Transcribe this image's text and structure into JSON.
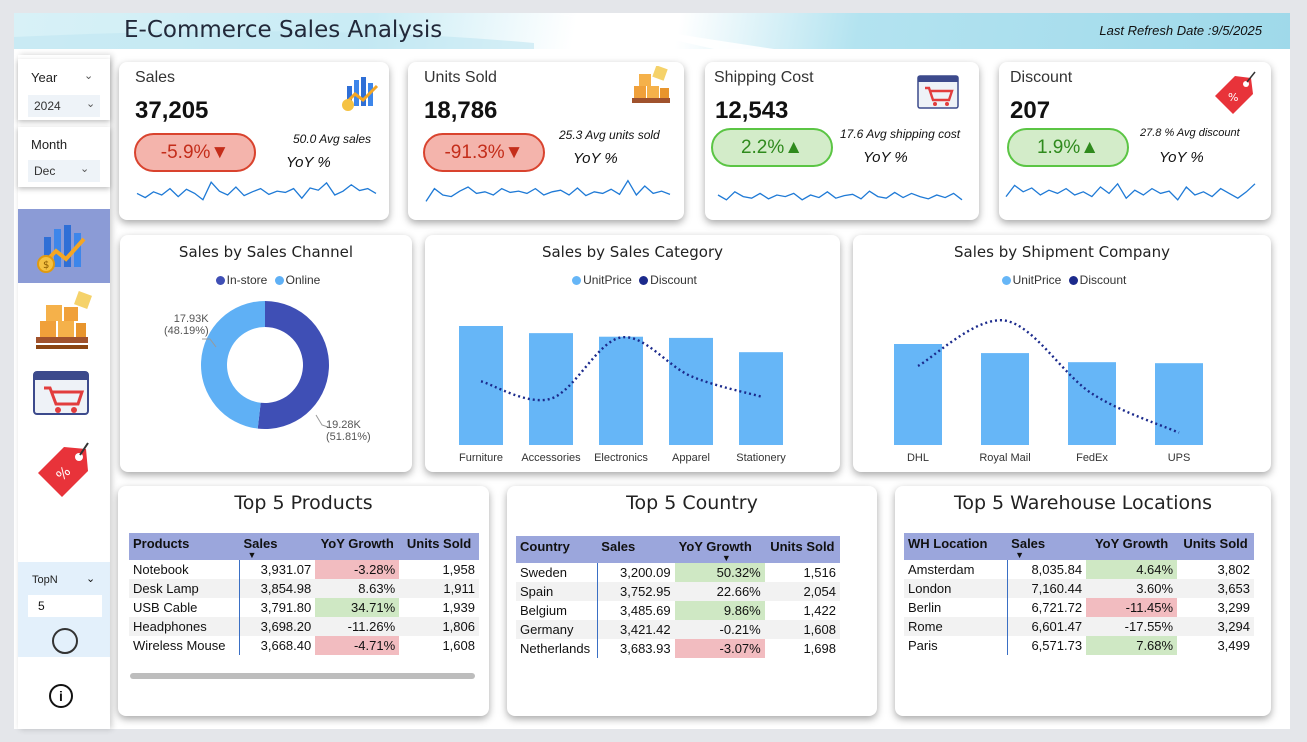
{
  "header": {
    "title": "E-Commerce Sales Analysis",
    "refresh": "Last Refresh Date :9/5/2025"
  },
  "sidebar": {
    "year": {
      "label": "Year",
      "value": "2024"
    },
    "month": {
      "label": "Month",
      "value": "Dec"
    },
    "nav": [
      {
        "icon": "sales-chart-icon",
        "active": true
      },
      {
        "icon": "boxes-icon"
      },
      {
        "icon": "cart-icon"
      },
      {
        "icon": "discount-tag-icon"
      }
    ],
    "topn": {
      "label": "TopN",
      "value": "5"
    }
  },
  "kpis": [
    {
      "name": "Sales",
      "value": "37,205",
      "change": "-5.9%▼",
      "trend": "neg",
      "avg": "50.0 Avg sales",
      "yoy": "YoY %",
      "spark": [
        0.55,
        0.42,
        0.6,
        0.5,
        0.7,
        0.45,
        0.68,
        0.55,
        0.35,
        0.9,
        0.62,
        0.5,
        0.75,
        0.48,
        0.6,
        0.7,
        0.52,
        0.62,
        0.58,
        0.7,
        0.4,
        0.72,
        0.65,
        0.88,
        0.5,
        0.62,
        0.82,
        0.64,
        0.7,
        0.55
      ]
    },
    {
      "name": "Units Sold",
      "value": "18,786",
      "change": "-91.3%▼",
      "trend": "neg",
      "avg": "25.3 Avg units sold",
      "yoy": "YoY %",
      "spark": [
        0.3,
        0.7,
        0.5,
        0.45,
        0.62,
        0.75,
        0.55,
        0.6,
        0.5,
        0.7,
        0.58,
        0.62,
        0.55,
        0.7,
        0.5,
        0.6,
        0.65,
        0.5,
        0.72,
        0.48,
        0.6,
        0.55,
        0.68,
        0.52,
        0.95,
        0.5,
        0.78,
        0.55,
        0.62,
        0.52
      ]
    },
    {
      "name": "Shipping Cost",
      "value": "12,543",
      "change": "2.2%▲",
      "trend": "pos",
      "avg": "17.6 Avg shipping cost",
      "yoy": "YoY %",
      "spark": [
        0.5,
        0.35,
        0.6,
        0.45,
        0.4,
        0.55,
        0.38,
        0.5,
        0.45,
        0.55,
        0.35,
        0.5,
        0.42,
        0.6,
        0.4,
        0.48,
        0.52,
        0.38,
        0.62,
        0.45,
        0.4,
        0.58,
        0.42,
        0.55,
        0.45,
        0.38,
        0.5,
        0.42,
        0.55,
        0.35
      ]
    },
    {
      "name": "Discount",
      "value": "207",
      "change": "1.9%▲",
      "trend": "pos",
      "avg": "27.8 % Avg discount",
      "yoy": "YoY %",
      "spark": [
        0.45,
        0.8,
        0.6,
        0.72,
        0.5,
        0.65,
        0.55,
        0.7,
        0.5,
        0.6,
        0.45,
        0.75,
        0.55,
        0.85,
        0.4,
        0.65,
        0.5,
        0.7,
        0.55,
        0.62,
        0.35,
        0.75,
        0.5,
        0.6,
        0.45,
        0.7,
        0.55,
        0.4,
        0.6,
        0.85
      ]
    }
  ],
  "channel": {
    "title": "Sales by Sales Channel",
    "legend": [
      {
        "label": "In-store",
        "color": "#3f4fb5"
      },
      {
        "label": "Online",
        "color": "#5fb0f5"
      }
    ],
    "chart_data": {
      "type": "pie",
      "labels": [
        "Online",
        "In-store"
      ],
      "values": [
        17.93,
        19.28
      ],
      "units": "K",
      "percent": [
        "48.19%",
        "51.81%"
      ]
    },
    "label_online": "17.93K",
    "label_online_pct": "(48.19%)",
    "label_instore": "19.28K",
    "label_instore_pct": "(51.81%)"
  },
  "category": {
    "title": "Sales by Sales Category",
    "legend": [
      {
        "label": "UnitPrice",
        "color": "#66b6f7"
      },
      {
        "label": "Discount",
        "color": "#1b2a8c"
      }
    ],
    "chart_data": {
      "type": "bar",
      "categories": [
        "Furniture",
        "Accessories",
        "Electronics",
        "Apparel",
        "Stationery"
      ],
      "series": [
        {
          "name": "UnitPrice",
          "values": [
            1.0,
            0.94,
            0.91,
            0.9,
            0.78
          ]
        },
        {
          "name": "Discount",
          "values": [
            0.35,
            0.18,
            0.78,
            0.4,
            0.2
          ]
        }
      ]
    }
  },
  "shipment": {
    "title": "Sales by Shipment Company",
    "legend": [
      {
        "label": "UnitPrice",
        "color": "#66b6f7"
      },
      {
        "label": "Discount",
        "color": "#1b2a8c"
      }
    ],
    "chart_data": {
      "type": "bar",
      "categories": [
        "DHL",
        "Royal Mail",
        "FedEx",
        "UPS"
      ],
      "series": [
        {
          "name": "UnitPrice",
          "values": [
            1.0,
            0.91,
            0.82,
            0.81
          ]
        },
        {
          "name": "Discount",
          "values": [
            0.58,
            0.94,
            0.36,
            0.05
          ]
        }
      ]
    }
  },
  "products": {
    "title": "Top 5 Products",
    "columns": [
      "Products",
      "Sales",
      "YoY Growth",
      "Units Sold"
    ],
    "rows": [
      [
        "Notebook",
        "3,931.07",
        "-3.28%",
        "1,958",
        "r"
      ],
      [
        "Desk Lamp",
        "3,854.98",
        "8.63%",
        "1,911",
        "g"
      ],
      [
        "USB Cable",
        "3,791.80",
        "34.71%",
        "1,939",
        "g"
      ],
      [
        "Headphones",
        "3,698.20",
        "-11.26%",
        "1,806",
        "r"
      ],
      [
        "Wireless Mouse",
        "3,668.40",
        "-4.71%",
        "1,608",
        "r"
      ]
    ]
  },
  "country": {
    "title": "Top 5 Country",
    "columns": [
      "Country",
      "Sales",
      "YoY Growth",
      "Units Sold"
    ],
    "rows": [
      [
        "Sweden",
        "3,200.09",
        "50.32%",
        "1,516",
        "g"
      ],
      [
        "Spain",
        "3,752.95",
        "22.66%",
        "2,054",
        "g"
      ],
      [
        "Belgium",
        "3,485.69",
        "9.86%",
        "1,422",
        "g"
      ],
      [
        "Germany",
        "3,421.42",
        "-0.21%",
        "1,608",
        "r"
      ],
      [
        "Netherlands",
        "3,683.93",
        "-3.07%",
        "1,698",
        "r"
      ]
    ]
  },
  "warehouse": {
    "title": "Top 5 Warehouse Locations",
    "columns": [
      "WH Location",
      "Sales",
      "YoY Growth",
      "Units Sold"
    ],
    "rows": [
      [
        "Amsterdam",
        "8,035.84",
        "4.64%",
        "3,802",
        "g"
      ],
      [
        "London",
        "7,160.44",
        "3.60%",
        "3,653",
        "g"
      ],
      [
        "Berlin",
        "6,721.72",
        "-11.45%",
        "3,299",
        "r"
      ],
      [
        "Rome",
        "6,601.47",
        "-17.55%",
        "3,294",
        "r"
      ],
      [
        "Paris",
        "6,571.73",
        "7.68%",
        "3,499",
        "g"
      ]
    ]
  }
}
